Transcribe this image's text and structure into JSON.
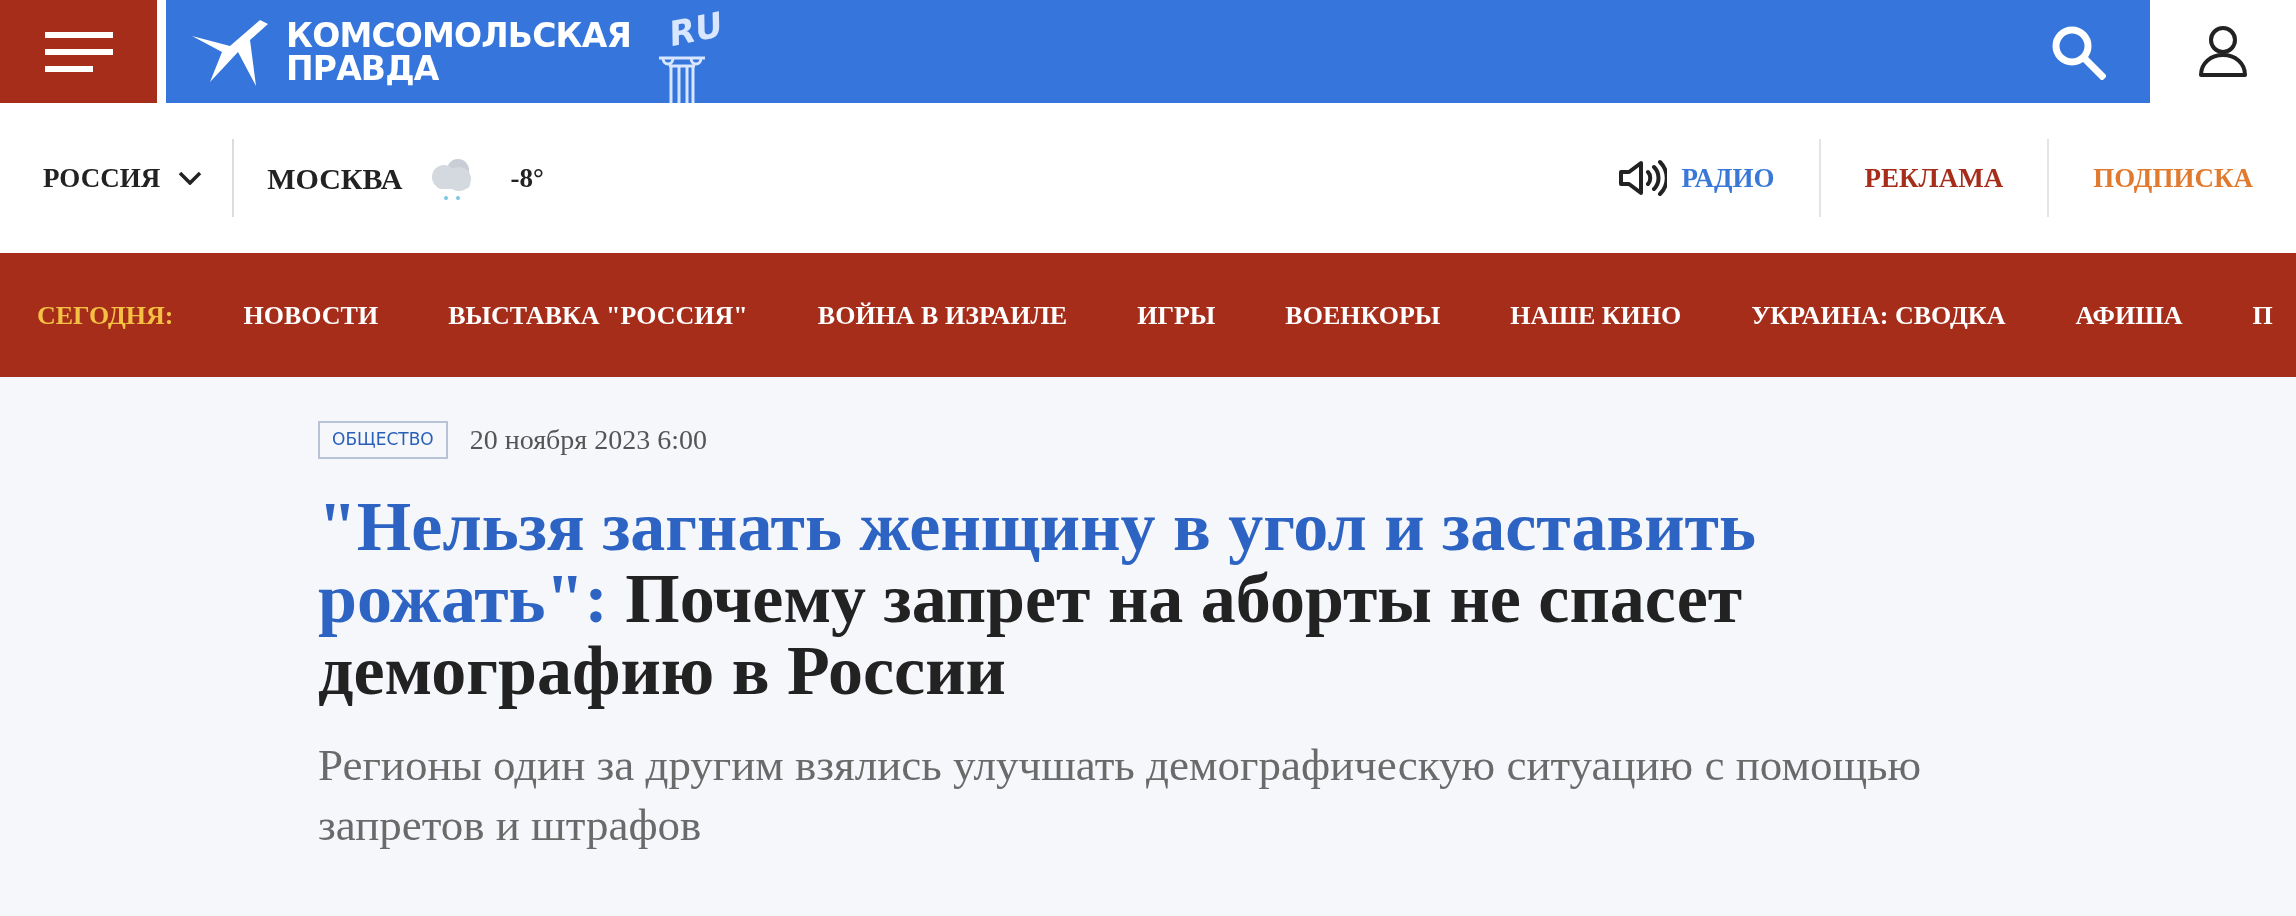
{
  "header": {
    "logo_lines": [
      "КОМСОМОЛЬСКАЯ",
      "ПРАВДА"
    ],
    "logo_badge": "RU"
  },
  "subheader": {
    "region": "РОССИЯ",
    "city": "МОСКВА",
    "temperature": "-8°",
    "links": [
      {
        "label": "РАДИО",
        "kind": "radio",
        "color": "#3a78d8"
      },
      {
        "label": "РЕКЛАМА",
        "kind": "plain",
        "color": "#a52d1a"
      },
      {
        "label": "ПОДПИСКА",
        "kind": "plain",
        "color": "#e07a2e"
      }
    ]
  },
  "nav": {
    "label": "СЕГОДНЯ:",
    "items": [
      "НОВОСТИ",
      "ВЫСТАВКА \"РОССИЯ\"",
      "ВОЙНА В ИЗРАИЛЕ",
      "ИГРЫ",
      "ВОЕНКОРЫ",
      "НАШЕ КИНО",
      "УКРАИНА: СВОДКА",
      "АФИША",
      "П"
    ]
  },
  "article": {
    "category": "ОБЩЕСТВО",
    "date": "20 ноября 2023 6:00",
    "headline_quote": "\"Нельзя загнать женщину в угол и заставить рожать\":",
    "headline": "Почему запрет на аборты не спасет демографию в России",
    "lead": "Регионы один за другим взялись улучшать демографическую ситуацию с помощью запретов и штрафов"
  }
}
